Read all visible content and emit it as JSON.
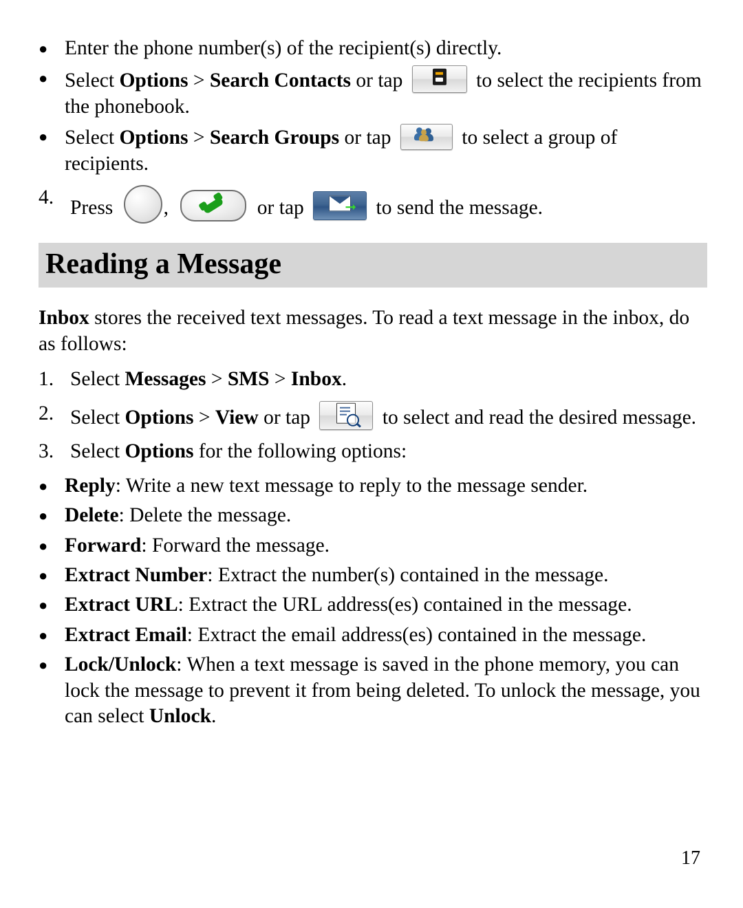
{
  "page": {
    "number": "17"
  },
  "top_list": {
    "bullet_glyph": "●",
    "items": [
      {
        "id": "enter-number",
        "text_1": "Enter the phone number(s) of the recipient(s) directly."
      },
      {
        "id": "search-contacts",
        "text_1": "Select ",
        "bold_1": "Options",
        "text_2": " > ",
        "bold_2": "Search Contacts",
        "text_3": " or tap ",
        "icon": "contacts-card-icon",
        "text_4": " to select the recipients from the phonebook."
      },
      {
        "id": "search-groups",
        "text_1": "Select ",
        "bold_1": "Options",
        "text_2": "  > ",
        "bold_2": "Search Groups",
        "text_3": " or tap ",
        "icon": "groups-people-icon",
        "text_4": " to select a group of recipients."
      }
    ]
  },
  "step4": {
    "number": "4.",
    "text_1": "Press ",
    "key_ok": "ok-key",
    "separator": ", ",
    "key_call": "call-key",
    "text_2": " or tap ",
    "icon": "send-envelope-icon",
    "text_3": " to send the message."
  },
  "section": {
    "heading": "Reading a Message",
    "intro_bold": "Inbox",
    "intro_text": " stores the received text messages. To read a text message in the inbox, do as follows:"
  },
  "steps": [
    {
      "number": "1.",
      "text_1": "Select ",
      "bold_1": "Messages",
      "text_2": " > ",
      "bold_2": "SMS",
      "text_3": " > ",
      "bold_3": "Inbox",
      "text_4": "."
    },
    {
      "number": "2.",
      "text_1": "Select ",
      "bold_1": "Options",
      "text_2": " > ",
      "bold_2": "View",
      "text_3": " or tap ",
      "icon": "view-message-icon",
      "text_4": " to select and read the desired message."
    },
    {
      "number": "3.",
      "text_1": "Select ",
      "bold_1": "Options",
      "text_2": " for the following options:"
    }
  ],
  "options": [
    {
      "bold": "Reply",
      "text": ": Write a new text message to reply to the message sender."
    },
    {
      "bold": "Delete",
      "text": ": Delete the message."
    },
    {
      "bold": "Forward",
      "text": ": Forward the message."
    },
    {
      "bold": "Extract Number",
      "text": ": Extract the number(s) contained in the message."
    },
    {
      "bold": "Extract URL",
      "text": ": Extract the URL address(es) contained in the message."
    },
    {
      "bold": "Extract Email",
      "text": ": Extract the email address(es) contained in the message."
    },
    {
      "bold": "Lock/Unlock",
      "text_1": ": When a text message is saved in the phone memory, you can lock the message to prevent it from being deleted. To unlock the message, you can select ",
      "bold_2": "Unlock",
      "text_2": "."
    }
  ]
}
